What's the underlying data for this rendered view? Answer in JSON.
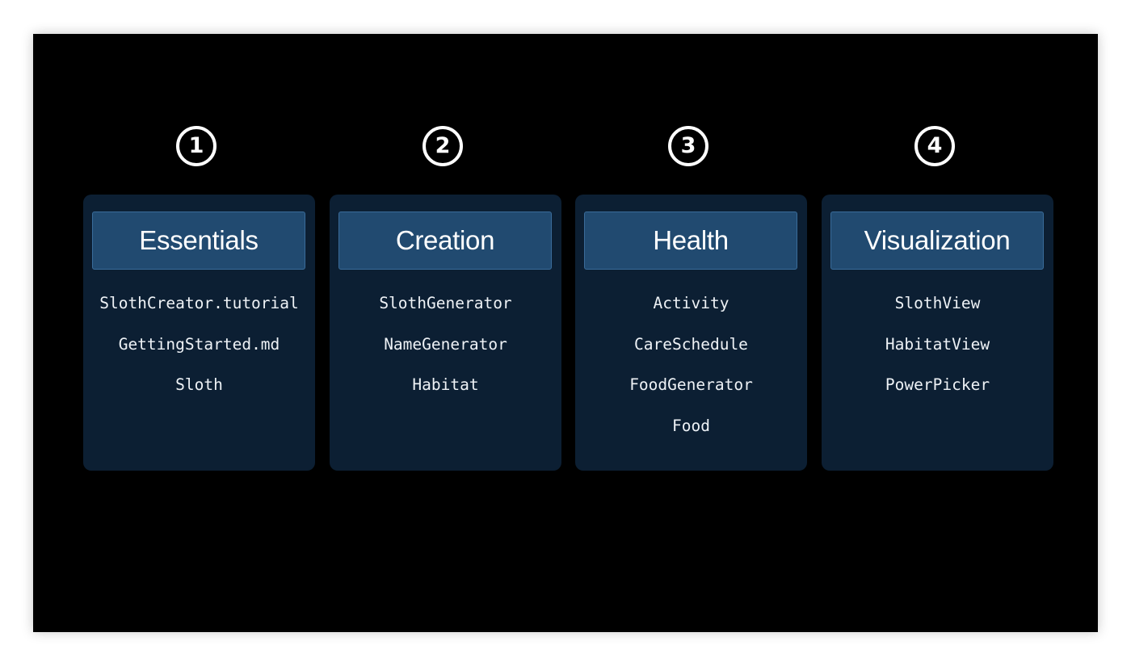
{
  "columns": [
    {
      "number": "1",
      "title": "Essentials",
      "items": [
        "SlothCreator.tutorial",
        "GettingStarted.md",
        "Sloth"
      ]
    },
    {
      "number": "2",
      "title": "Creation",
      "items": [
        "SlothGenerator",
        "NameGenerator",
        "Habitat"
      ]
    },
    {
      "number": "3",
      "title": "Health",
      "items": [
        "Activity",
        "CareSchedule",
        "FoodGenerator",
        "Food"
      ]
    },
    {
      "number": "4",
      "title": "Visualization",
      "items": [
        "SlothView",
        "HabitatView",
        "PowerPicker"
      ]
    }
  ],
  "colors": {
    "background": "#000000",
    "card": "#0c1f33",
    "header": "#214a70",
    "header_border": "#3a6c9a",
    "text": "#ffffff"
  }
}
